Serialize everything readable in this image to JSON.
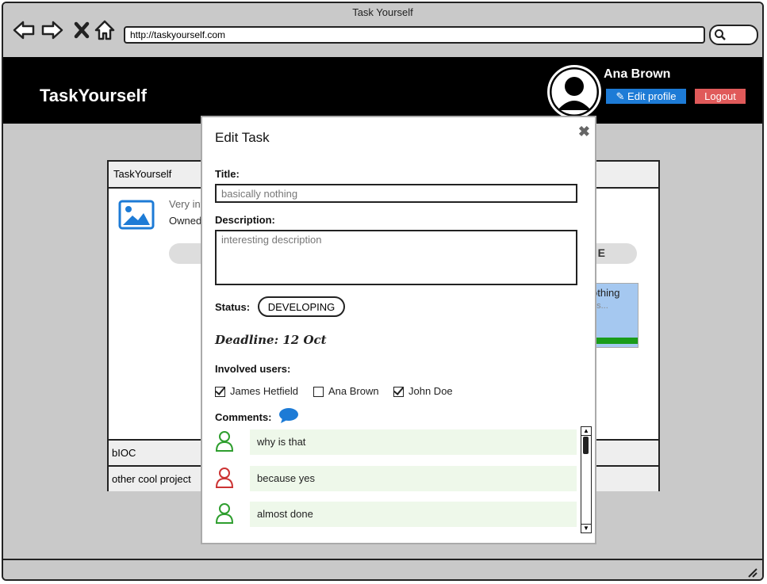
{
  "window": {
    "title": "Task Yourself",
    "url": "http://taskyourself.com"
  },
  "header": {
    "brand": "TaskYourself",
    "user_name": "Ana Brown",
    "edit_profile_label": "Edit profile",
    "logout_label": "Logout"
  },
  "background": {
    "panel_header": "TaskYourself",
    "project_desc": "Very int",
    "project_owner": "Owned",
    "pill_text": "E",
    "task_card_title": "othing",
    "task_card_sub": "es...",
    "list_rows": [
      "bIOC",
      "other cool project"
    ]
  },
  "modal": {
    "title": "Edit Task",
    "close_icon": "close-icon",
    "title_label": "Title:",
    "title_value": "basically nothing",
    "description_label": "Description:",
    "description_value": "interesting description",
    "status_label": "Status:",
    "status_value": "DEVELOPING",
    "deadline": "Deadline: 12 Oct",
    "involved_label": "Involved users:",
    "users": [
      {
        "name": "James Hetfield",
        "checked": true
      },
      {
        "name": "Ana Brown",
        "checked": false
      },
      {
        "name": "John Doe",
        "checked": true
      }
    ],
    "comments_label": "Comments:",
    "comments": [
      {
        "text": "why is that",
        "color": "#2e9e2e"
      },
      {
        "text": "because yes",
        "color": "#cc3333"
      },
      {
        "text": "almost done",
        "color": "#2e9e2e"
      }
    ]
  },
  "colors": {
    "accent_blue": "#1d7bd6",
    "logout_red": "#e05a5a",
    "comment_bg": "#eef8ea"
  }
}
